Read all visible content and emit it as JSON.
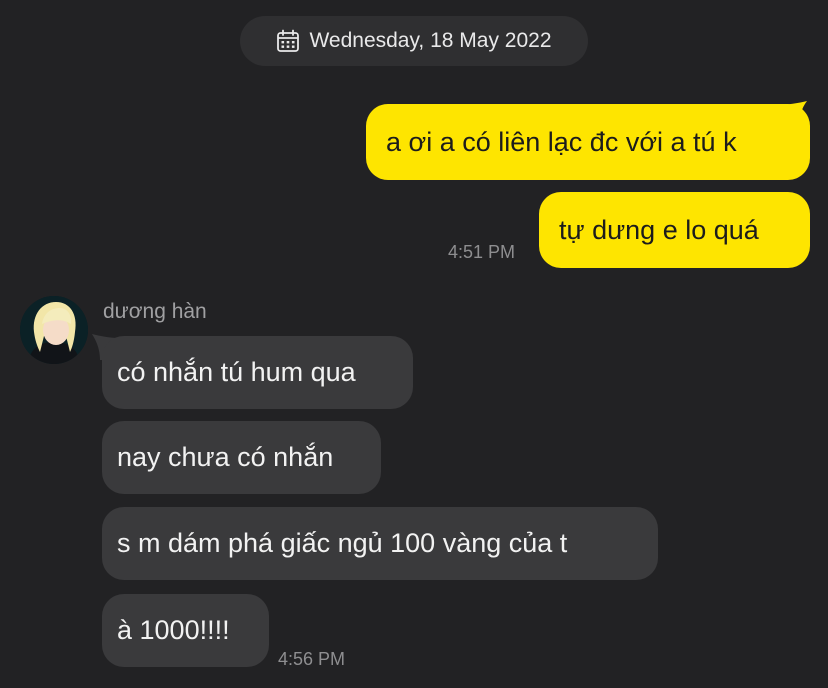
{
  "date_header": {
    "icon": "calendar-icon",
    "text": "Wednesday, 18 May 2022"
  },
  "outgoing_messages": [
    {
      "text": "a ơi a có liên lạc đc với a tú k"
    },
    {
      "text": "tự dưng e lo quá"
    }
  ],
  "outgoing_time": "4:51 PM",
  "incoming": {
    "sender_name": "dương hàn",
    "messages": [
      {
        "text": "có nhắn tú hum qua"
      },
      {
        "text": "nay chưa có nhắn"
      },
      {
        "text": "s m dám phá giấc ngủ 100 vàng của t"
      },
      {
        "text": "à 1000!!!!"
      }
    ],
    "time": "4:56 PM"
  },
  "colors": {
    "background": "#222224",
    "outgoing_bubble": "#fee500",
    "incoming_bubble": "#3a3a3c",
    "date_pill": "#2f2f31",
    "timestamp": "#8e8e90"
  }
}
